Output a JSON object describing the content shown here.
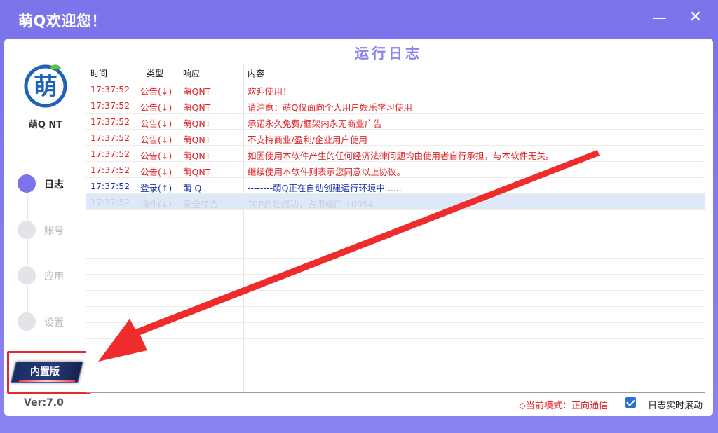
{
  "window": {
    "title": "萌Q欢迎您！",
    "minimize_glyph": "—",
    "close_glyph": "✕"
  },
  "sidebar": {
    "app_name": "萌Q NT",
    "nav": [
      {
        "label": "日志",
        "active": true
      },
      {
        "label": "账号",
        "active": false
      },
      {
        "label": "应用",
        "active": false
      },
      {
        "label": "设置",
        "active": false
      }
    ],
    "badge_label": "内置版",
    "version": "Ver:7.0"
  },
  "log": {
    "title": "运行日志",
    "columns": [
      "时间",
      "类型",
      "响应",
      "内容"
    ],
    "rows": [
      {
        "time": "17:37:52",
        "type": "公告(↓)",
        "resp": "萌QNT",
        "content": "欢迎使用！",
        "style": "red"
      },
      {
        "time": "17:37:52",
        "type": "公告(↓)",
        "resp": "萌QNT",
        "content": "请注意：萌Q仅面向个人用户娱乐学习使用",
        "style": "red"
      },
      {
        "time": "17:37:52",
        "type": "公告(↓)",
        "resp": "萌QNT",
        "content": "承诺永久免费/框架内永无商业广告",
        "style": "red"
      },
      {
        "time": "17:37:52",
        "type": "公告(↓)",
        "resp": "萌QNT",
        "content": "不支持商业/盈利/企业用户使用",
        "style": "red"
      },
      {
        "time": "17:37:52",
        "type": "公告(↓)",
        "resp": "萌QNT",
        "content": "如因使用本软件产生的任何经济法律问题均由使用者自行承担，与本软件无关。",
        "style": "red"
      },
      {
        "time": "17:37:52",
        "type": "公告(↓)",
        "resp": "萌QNT",
        "content": "继续使用本软件则表示您同意以上协议。",
        "style": "red"
      },
      {
        "time": "17:37:52",
        "type": "登录(↑)",
        "resp": "萌 Q",
        "content": "--------萌Q正在自动创建运行环境中......",
        "style": "blue"
      },
      {
        "time": "17:37:52",
        "type": "插件(↓)",
        "resp": "安全综合",
        "content": "TCP启动成功，占用端口:10954",
        "style": "selected"
      }
    ]
  },
  "footer": {
    "mode_text": "◇当前模式：正向通信",
    "autoscroll_label": "日志实时滚动",
    "autoscroll_checked": true
  },
  "colors": {
    "accent": "#7b73ea",
    "notice": "#e02020",
    "login": "#1a33a8",
    "highlight_box": "#e8262d"
  }
}
